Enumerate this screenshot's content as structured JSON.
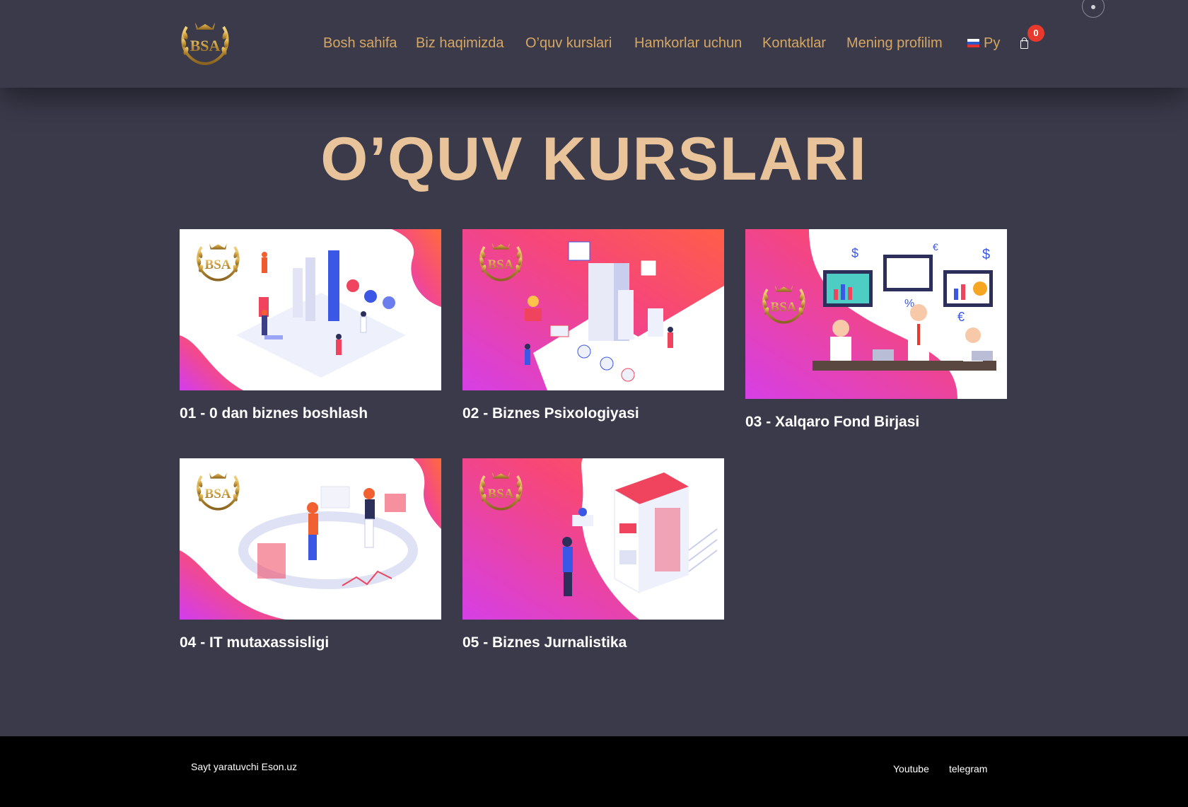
{
  "header": {
    "logo_text": "BSA",
    "nav": [
      {
        "label": "Bosh sahifa"
      },
      {
        "label": "Biz haqimizda"
      },
      {
        "label": "O’quv kurslari"
      },
      {
        "label": "Hamkorlar uchun"
      },
      {
        "label": "Kontaktlar"
      },
      {
        "label": "Mening profilim"
      }
    ],
    "language": {
      "label": "Ру",
      "flag": "russia-flag-icon"
    },
    "cart": {
      "count": "0",
      "icon": "cart-icon"
    },
    "accent_color": "#d6a763",
    "badge_color": "#e8392c"
  },
  "page": {
    "title": "O’QUV KURSLARI",
    "title_color": "#e9c39a",
    "background": "#3a3a4b"
  },
  "courses": [
    {
      "title": "01 - 0 dan biznes boshlash",
      "image_logo": "BSA"
    },
    {
      "title": "02 - Biznes Psixologiyasi",
      "image_logo": "BSA"
    },
    {
      "title": "03 - Xalqaro Fond Birjasi",
      "image_logo": "BSA"
    },
    {
      "title": "04 - IT mutaxassisligi",
      "image_logo": "BSA"
    },
    {
      "title": "05 - Biznes Jurnalistika",
      "image_logo": "BSA"
    }
  ],
  "footer": {
    "credit": "Sayt yaratuvchi Eson.uz",
    "links": [
      {
        "label": "Youtube"
      },
      {
        "label": "telegram"
      }
    ]
  }
}
